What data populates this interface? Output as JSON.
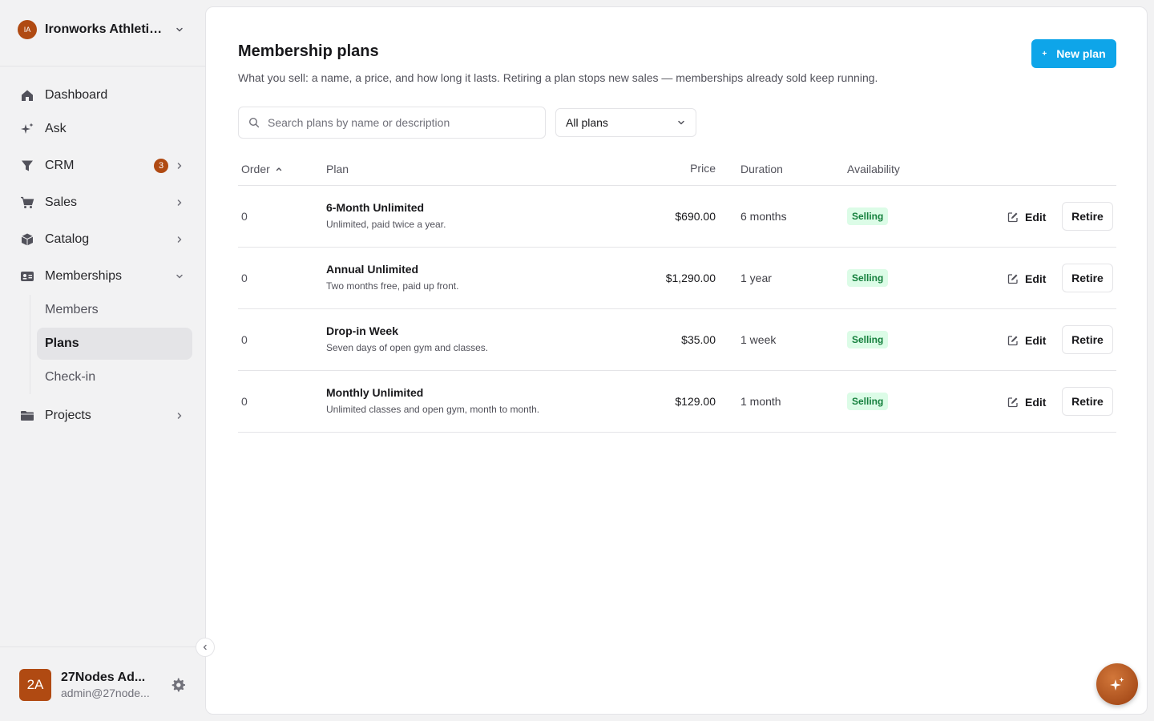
{
  "org": {
    "initials": "IA",
    "name": "Ironworks Athletic..."
  },
  "nav": {
    "dashboard": "Dashboard",
    "ask": "Ask",
    "crm": "CRM",
    "crm_badge": "3",
    "sales": "Sales",
    "catalog": "Catalog",
    "memberships": "Memberships",
    "members": "Members",
    "plans": "Plans",
    "checkin": "Check-in",
    "projects": "Projects"
  },
  "user": {
    "initials": "2A",
    "name": "27Nodes Ad...",
    "email": "admin@27node..."
  },
  "page": {
    "title": "Membership plans",
    "subtitle": "What you sell: a name, a price, and how long it lasts. Retiring a plan stops new sales — memberships already sold keep running.",
    "new_button": "New plan",
    "search_placeholder": "Search plans by name or description",
    "filter_value": "All plans"
  },
  "table": {
    "headers": {
      "order": "Order",
      "plan": "Plan",
      "price": "Price",
      "duration": "Duration",
      "availability": "Availability"
    },
    "edit_label": "Edit",
    "retire_label": "Retire",
    "rows": [
      {
        "order": "0",
        "name": "6-Month Unlimited",
        "desc": "Unlimited, paid twice a year.",
        "price": "$690.00",
        "duration": "6 months",
        "status": "Selling"
      },
      {
        "order": "0",
        "name": "Annual Unlimited",
        "desc": "Two months free, paid up front.",
        "price": "$1,290.00",
        "duration": "1 year",
        "status": "Selling"
      },
      {
        "order": "0",
        "name": "Drop-in Week",
        "desc": "Seven days of open gym and classes.",
        "price": "$35.00",
        "duration": "1 week",
        "status": "Selling"
      },
      {
        "order": "0",
        "name": "Monthly Unlimited",
        "desc": "Unlimited classes and open gym, month to month.",
        "price": "$129.00",
        "duration": "1 month",
        "status": "Selling"
      }
    ]
  },
  "colors": {
    "accent": "#0ea5e9",
    "brand": "#b04a12",
    "selling_bg": "#dcfce7",
    "selling_fg": "#15803d"
  }
}
